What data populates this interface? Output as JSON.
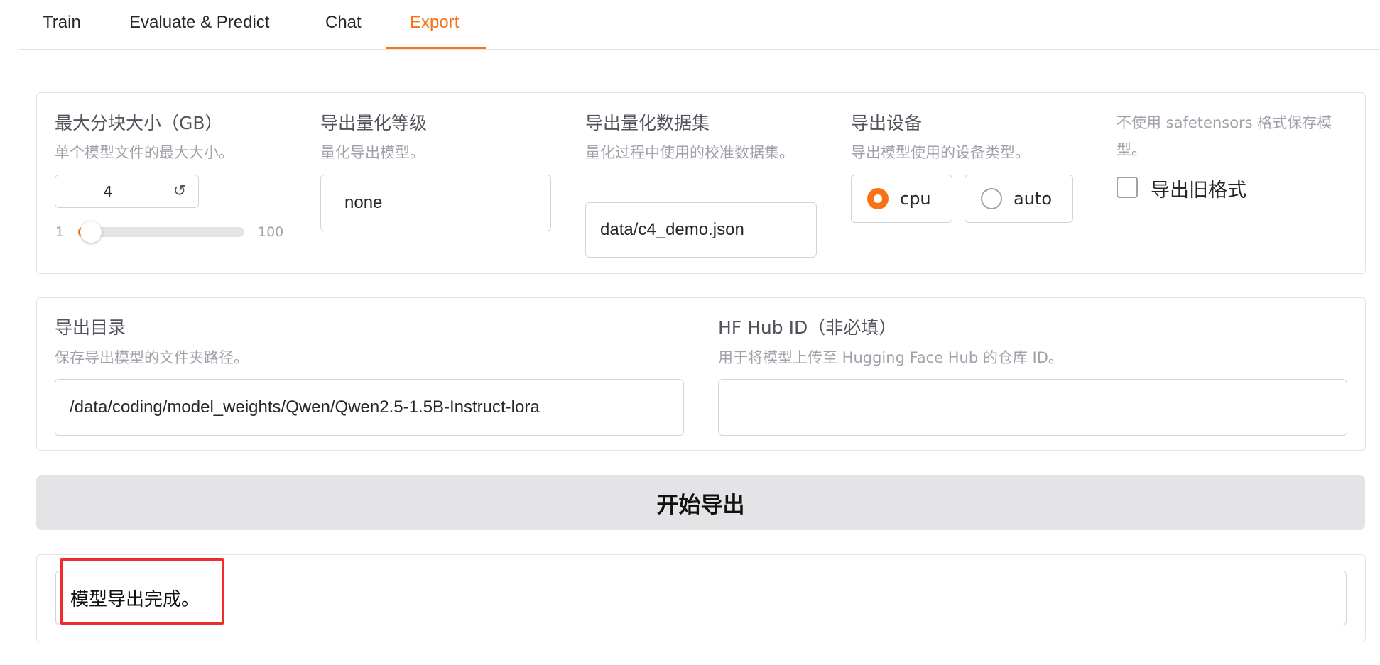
{
  "tabs": [
    {
      "label": "Train"
    },
    {
      "label": "Evaluate & Predict"
    },
    {
      "label": "Chat"
    },
    {
      "label": "Export"
    }
  ],
  "active_tab": "Export",
  "accent_color": "#f97316",
  "max_shard": {
    "label": "最大分块大小（GB）",
    "info": "单个模型文件的最大大小。",
    "value": "4",
    "min": "1",
    "max": "100",
    "reset_icon": "↺"
  },
  "quant_bit": {
    "label": "导出量化等级",
    "info": "量化导出模型。",
    "value": "none"
  },
  "quant_dataset": {
    "label": "导出量化数据集",
    "info": "量化过程中使用的校准数据集。",
    "value": "data/c4_demo.json"
  },
  "export_device": {
    "label": "导出设备",
    "info": "导出模型使用的设备类型。",
    "options": [
      "cpu",
      "auto"
    ],
    "selected": "cpu"
  },
  "legacy_format": {
    "info": "不使用 safetensors 格式保存模型。",
    "label": "导出旧格式",
    "checked": false
  },
  "export_dir": {
    "label": "导出目录",
    "info": "保存导出模型的文件夹路径。",
    "value": "/data/coding/model_weights/Qwen/Qwen2.5-1.5B-Instruct-lora"
  },
  "hub_id": {
    "label": "HF Hub ID（非必填）",
    "info": "用于将模型上传至 Hugging Face Hub 的仓库 ID。",
    "value": ""
  },
  "export_button": {
    "label": "开始导出"
  },
  "output": {
    "text": "模型导出完成。"
  }
}
